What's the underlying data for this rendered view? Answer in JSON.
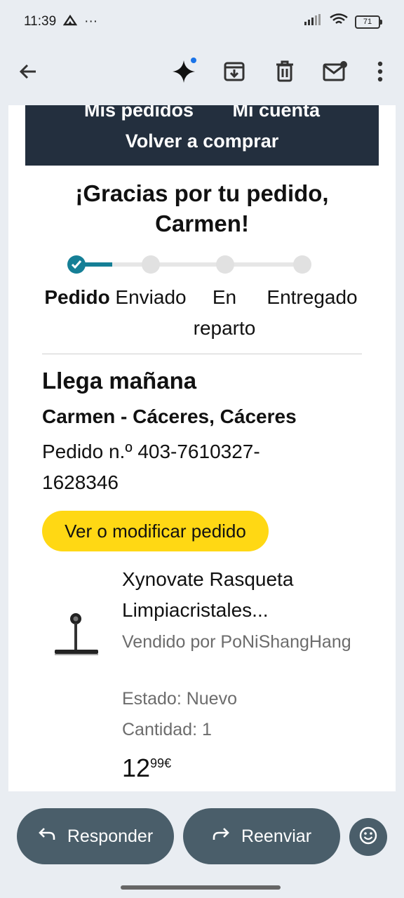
{
  "status_bar": {
    "time": "11:39",
    "extra": "···",
    "battery": "71"
  },
  "toolbar": {
    "icons": [
      "back-arrow-icon",
      "sparkle-icon",
      "archive-icon",
      "delete-icon",
      "mark-unread-icon",
      "more-vert-icon"
    ],
    "accent": "#1a73e8"
  },
  "email": {
    "nav": {
      "orders": "Mis pedidos",
      "account": "Mi cuenta",
      "buy_again": "Volver a comprar"
    },
    "thanks": "¡Gracias por tu pedido, Carmen!",
    "steps": [
      "Pedido",
      "Enviado",
      "En reparto",
      "Entregado"
    ],
    "current_step": 1,
    "arrival": "Llega mañana",
    "address": "Carmen - Cáceres, Cáceres",
    "order_number": "Pedido n.º 403-7610327-1628346",
    "view_button": "Ver o modificar pedido",
    "product": {
      "title": "Xynovate Rasqueta Limpiacristales...",
      "seller": "Vendido por PoNiShangHang",
      "state": "Estado: Nuevo",
      "quantity": "Cantidad: 1",
      "price_whole": "12",
      "price_fraction": "99€"
    },
    "colors": {
      "nav_bg": "#232f3e",
      "track": "#157f96",
      "button": "#ffd814"
    }
  },
  "actions": {
    "reply": "Responder",
    "forward": "Reenviar"
  }
}
